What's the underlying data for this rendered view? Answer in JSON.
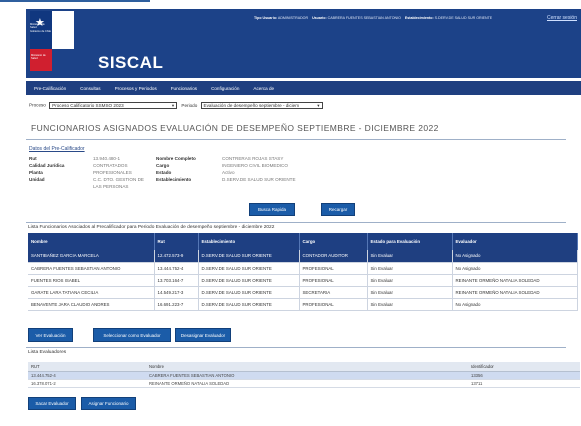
{
  "header": {
    "ministry": "Ministerio de Salud",
    "ministry_sub": "Gobierno de Chile",
    "ministry2": "Ministerio de Salud",
    "app_title": "SISCAL",
    "user_type_label": "Tipo Usuario:",
    "user_type": "ADMINISTRADOR",
    "user_label": "Usuario:",
    "user_name": "CABRERA FUENTES SEBASTIAN ANTONIO",
    "establishment_label": "Establecimiento:",
    "establishment": "S.DERV.DE SALUD SUR ORIENTE",
    "logout": "Cerrar sesión"
  },
  "menu": [
    "Pre-Calificación",
    "Consultas",
    "Procesos y Periodos",
    "Funcionarios",
    "Configuración",
    "Acerca de"
  ],
  "filters": {
    "process_label": "Proceso",
    "process_value": "Proceso Calificatorio SSMSO 2023",
    "period_label": "Periodo",
    "period_value": "Evaluación de desempeño septiembre - diciem"
  },
  "page_title": "FUNCIONARIOS ASIGNADOS EVALUACIÓN DE DESEMPEÑO SEPTIEMBRE - DICIEMBRE 2022",
  "precalificador": {
    "section_title": "Datos del Pre-Calificador",
    "rut_label": "Rut",
    "rut": "13.940.480-1",
    "calidad_label": "Calidad Jurídica",
    "calidad": "CONTRATADOS",
    "planta_label": "Planta",
    "planta": "PROFESIONALES",
    "unidad_label": "Unidad",
    "unidad": "C.C. DTO. GESTION DE LAS PERSONAS",
    "nombre_label": "Nombre Completo",
    "nombre": "CONTRERAS ROJAS STASY",
    "cargo_label": "Cargo",
    "cargo": "INGENIERO CIVIL BIOMEDICO",
    "estado_label": "Estado",
    "estado": "Activo",
    "establecimiento_label": "Establecimiento",
    "establecimiento": "D.SERV.DE SALUD SUR ORIENTE"
  },
  "buttons": {
    "quick_search": "Busca Rapida",
    "reload": "Recargar",
    "view_eval": "Ver Evaluación",
    "select_evaluator": "Seleccionar como Evaluador",
    "unassign_evaluator": "Desasignar Evaluador",
    "remove_evaluator": "Sacar Evaluador",
    "assign_staff": "Asignar Funcionario"
  },
  "funcionarios": {
    "title": "Lista Funcionarios Asociados al Precalificador para Periodo Evaluación de desempeño septiembre - diciembre 2022",
    "columns": [
      "Nombre",
      "Rut",
      "Establecimiento",
      "Cargo",
      "Estado para Evaluación",
      "Evaluador"
    ],
    "rows": [
      [
        "SANTIBAÑEZ GARCIA MARCELA",
        "12.472.573-9",
        "D.SERV.DE SALUD SUR ORIENTE",
        "CONTADOR AUDITOR",
        "Sin Evaluar",
        "No Asignado"
      ],
      [
        "CABRERA FUENTES SEBASTIAN ANTONIO",
        "13.444.752-4",
        "D.SERV.DE SALUD SUR ORIENTE",
        "PROFESIONAL",
        "Sin Evaluar",
        "No Asignado"
      ],
      [
        "FUENTES RIOS ISABEL",
        "13.703.164-7",
        "D.SERV.DE SALUD SUR ORIENTE",
        "PROFESIONAL",
        "Sin Evaluar",
        "REINANTE ORMEÑO NATALIA SOLEDAD"
      ],
      [
        "GARATE LARA TATIANA CECILIA",
        "14.549.217-3",
        "D.SERV.DE SALUD SUR ORIENTE",
        "SECRETARIA",
        "Sin Evaluar",
        "REINANTE ORMEÑO NATALIA SOLEDAD"
      ],
      [
        "BENAVENTE JARA CLAUDIO ANDRES",
        "16.691.223-7",
        "D.SERV.DE SALUD SUR ORIENTE",
        "PROFESIONAL",
        "Sin Evaluar",
        "No Asignado"
      ]
    ]
  },
  "evaluadores": {
    "title": "Lista Evaluadores",
    "columns": [
      "RUT",
      "Nombre",
      "Identificador"
    ],
    "rows": [
      [
        "13.444.752-4",
        "CABRERA FUENTES SEBASTIAN ANTONIO",
        "13356"
      ],
      [
        "16.378.071-2",
        "REINANTE ORMEÑO NATALIA SOLEDAD",
        "13711"
      ]
    ]
  },
  "colors": {
    "header_blue": "#1c4288",
    "menu_blue": "#1f3f80",
    "button_blue": "#1b5ca8",
    "flag_red": "#d01f2f"
  }
}
